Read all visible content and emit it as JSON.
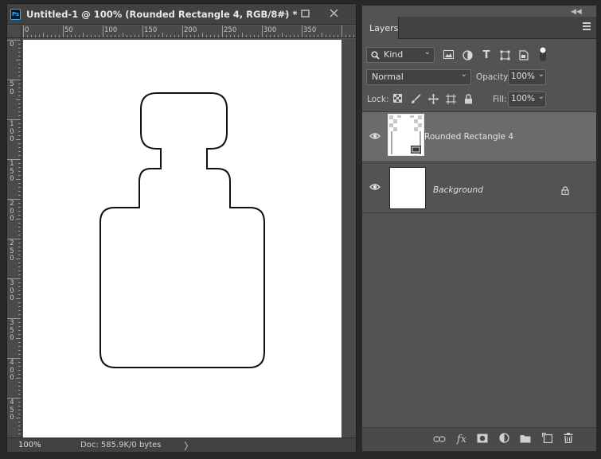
{
  "document": {
    "title": "Untitled-1 @ 100% (Rounded Rectangle 4, RGB/8#) *",
    "app_icon_text": "Ps",
    "window_controls": [
      "minimize-icon",
      "maximize-icon",
      "close-icon"
    ],
    "ruler_top_labels": [
      "0",
      "50",
      "100",
      "150",
      "200",
      "250",
      "300",
      "350"
    ],
    "ruler_left_labels": [
      "0",
      "50",
      "100",
      "150",
      "200",
      "250",
      "300",
      "350",
      "400",
      "450"
    ],
    "zoom": "100%",
    "doc_info": "Doc: 585.9K/0 bytes",
    "status_arrow": "〉"
  },
  "layers_panel": {
    "tab": "Layers",
    "filter": {
      "kind_label": "Kind",
      "icons": [
        "image-filter-icon",
        "adjustment-filter-icon",
        "type-filter-icon",
        "shape-filter-icon",
        "smart-object-filter-icon",
        "filter-toggle-icon"
      ]
    },
    "blend_mode": "Normal",
    "opacity_label": "Opacity:",
    "opacity_value": "100%",
    "lock_label": "Lock:",
    "lock_icons": [
      "lock-transparent-pixels-icon",
      "lock-image-pixels-icon",
      "lock-position-icon",
      "lock-artboard-icon",
      "lock-all-icon"
    ],
    "fill_label": "Fill:",
    "fill_value": "100%",
    "layers": [
      {
        "name": "Rounded Rectangle 4",
        "visible": true,
        "selected": true,
        "type": "shape"
      },
      {
        "name": "Background",
        "visible": true,
        "selected": false,
        "locked": true,
        "type": "background"
      }
    ],
    "footer_icons": [
      "link-layers-icon",
      "fx-icon",
      "add-mask-icon",
      "adjustment-layer-icon",
      "new-group-icon",
      "new-layer-icon",
      "delete-icon"
    ]
  },
  "colors": {
    "workspace": "#282828",
    "panel": "#535353",
    "titlebar": "#424242",
    "selected_layer": "#6b6b6b",
    "ps_accent": "#31a8ff"
  }
}
